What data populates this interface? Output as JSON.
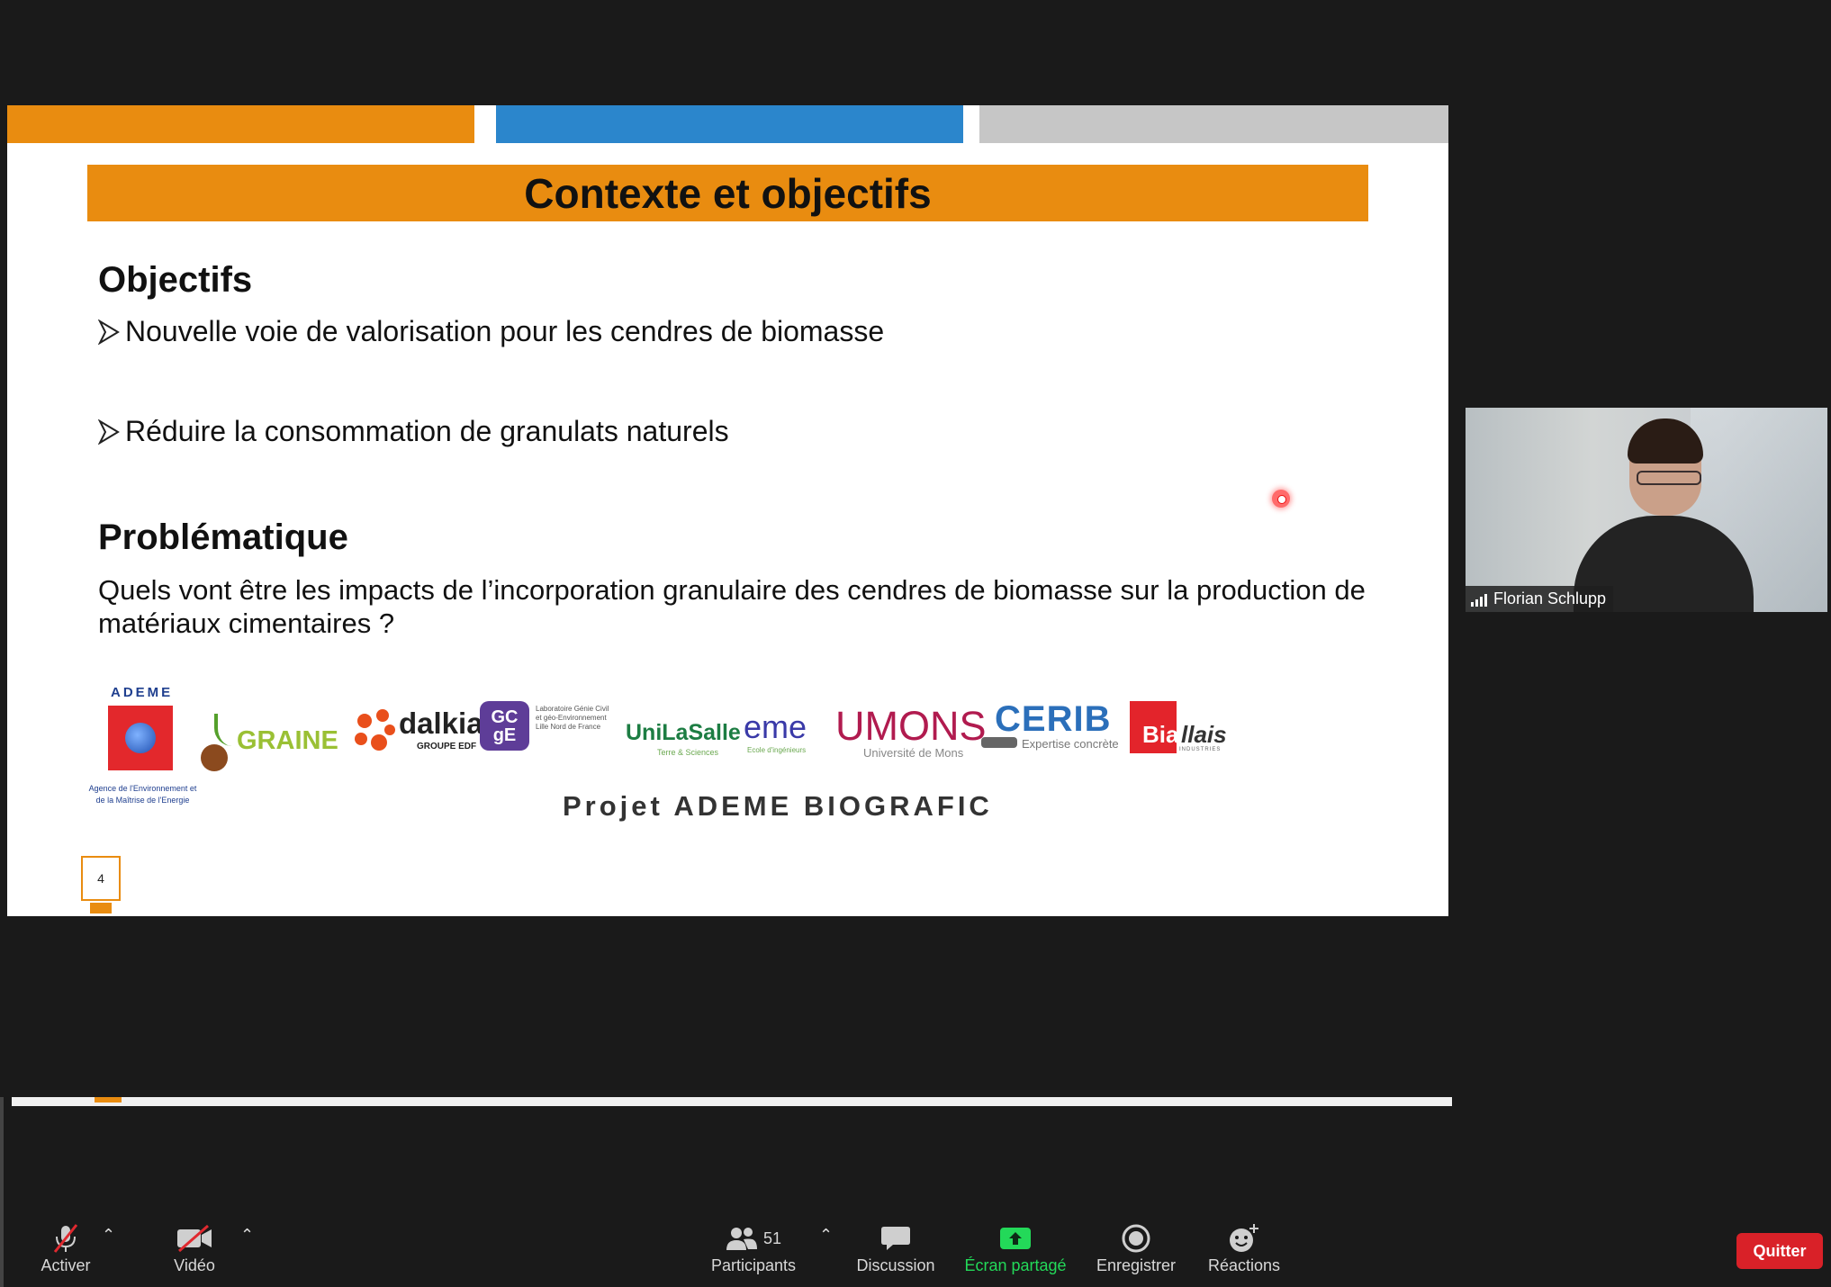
{
  "slide": {
    "title": "Contexte et objectifs",
    "objectives_heading": "Objectifs",
    "bullets": [
      "Nouvelle voie de valorisation pour les cendres de biomasse",
      "Réduire la consommation de granulats naturels"
    ],
    "problem_heading": "Problématique",
    "question": "Quels vont être les impacts de l’incorporation granulaire des cendres de biomasse sur la production de matériaux cimentaires ?",
    "project": "Projet ADEME BIOGRAFIC",
    "page_number": "4",
    "logos": {
      "ademe": "ADEME",
      "ademe_sub": "Agence de l'Environnement et de la Maîtrise de l'Energie",
      "graine": "GRAINE",
      "dalkia": "dalkia",
      "dalkia_sub": "GROUPE EDF",
      "lgcge": "GC gE",
      "lgcge_text": "Laboratoire Génie Civil et géo-Environnement Lille Nord de France",
      "unilasalle": "UniLaSalle",
      "unilasalle_sub": "Terre & Sciences",
      "eme": "eme",
      "eme_sub": "Ecole d'ingénieurs",
      "umons": "UMONS",
      "umons_sub": "Université de Mons",
      "cerib": "CERIB",
      "cerib_sub": "Expertise concrète",
      "biallais_red": "Bia",
      "biallais_rest": "llais",
      "biallais_sub": "INDUSTRIES"
    },
    "colors": {
      "orange": "#e98c10",
      "blue": "#2b86cc",
      "gray": "#c6c6c6"
    }
  },
  "participant": {
    "name": "Florian Schlupp"
  },
  "toolbar": {
    "mute_label": "Activer",
    "video_label": "Vidéo",
    "participants_label": "Participants",
    "participants_count": "51",
    "chat_label": "Discussion",
    "share_label": "Écran partagé",
    "record_label": "Enregistrer",
    "reactions_label": "Réactions",
    "quit_label": "Quitter",
    "share_color": "#23d959",
    "quit_color": "#d92128"
  }
}
